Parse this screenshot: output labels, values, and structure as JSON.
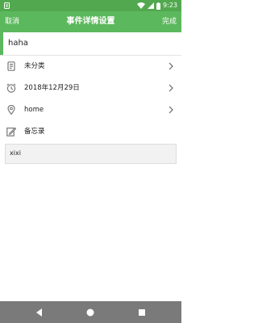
{
  "status_bar": {
    "time": "9:23",
    "icons": [
      "app-notification-icon",
      "wifi-icon",
      "signal-icon",
      "battery-icon"
    ]
  },
  "top_bar": {
    "cancel_label": "取消",
    "title": "事件详情设置",
    "done_label": "完成",
    "accent_color": "#5cb85c"
  },
  "event": {
    "title_value": "haha"
  },
  "rows": [
    {
      "icon": "category-icon",
      "label": "未分类",
      "has_chevron": true
    },
    {
      "icon": "alarm-clock-icon",
      "label": "2018年12月29日",
      "has_chevron": true
    },
    {
      "icon": "location-pin-icon",
      "label": "home",
      "has_chevron": true
    },
    {
      "icon": "memo-edit-icon",
      "label": "备忘录",
      "has_chevron": false
    }
  ],
  "memo": {
    "value": "xixi"
  },
  "nav_bar": {
    "buttons": [
      "back-icon",
      "home-icon",
      "recents-icon"
    ]
  }
}
